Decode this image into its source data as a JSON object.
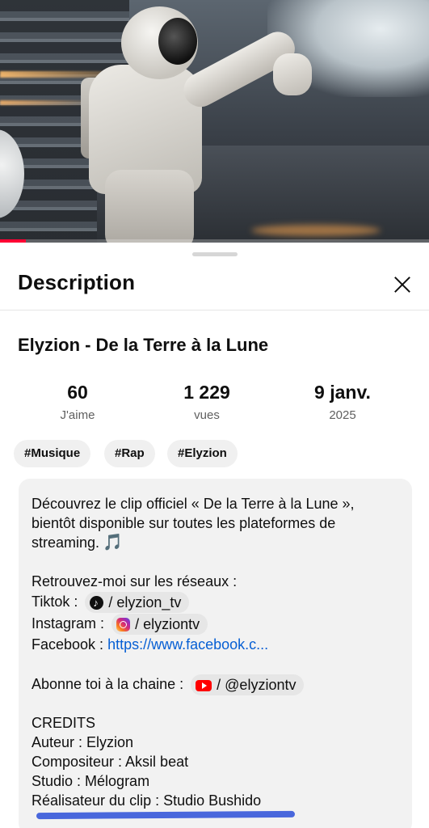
{
  "video": {
    "progress_fraction": 0.06,
    "colors": {
      "progress": "#ff0033"
    }
  },
  "sheet": {
    "title": "Description",
    "close_icon": "close-icon"
  },
  "video_title": "Elyzion - De la Terre à la Lune",
  "stats": {
    "likes": {
      "value": "60",
      "label": "J'aime"
    },
    "views": {
      "value": "1 229",
      "label": "vues"
    },
    "date": {
      "value": "9 janv.",
      "label": "2025"
    }
  },
  "tags": [
    "#Musique",
    "#Rap",
    "#Elyzion"
  ],
  "description": {
    "intro_1": "Découvrez le clip officiel « De la Terre à la Lune »,",
    "intro_2": "bientôt disponible sur toutes les plateformes de",
    "intro_3": "streaming.",
    "music_icon": "🎵",
    "socials_heading": "Retrouvez-moi sur les réseaux :",
    "tiktok_label": "Tiktok :",
    "tiktok_handle": "/ elyzion_tv",
    "instagram_label": "Instagram :",
    "instagram_handle": "/ elyziontv",
    "facebook_label": "Facebook :",
    "facebook_link": "https://www.facebook.c...",
    "subscribe_label": "Abonne toi à la chaine :",
    "youtube_handle": "/ @elyziontv",
    "credits_heading": "CREDITS",
    "credit_author": "Auteur : Elyzion",
    "credit_composer": "Compositeur : Aksil beat",
    "credit_studio": "Studio : Mélogram",
    "credit_director": "Réalisateur du clip : Studio Bushido"
  },
  "colors": {
    "link": "#065fd4",
    "chip_bg": "#f0f0f0",
    "desc_bg": "#f2f2f2",
    "highlight_underline": "#2b4fd8"
  }
}
